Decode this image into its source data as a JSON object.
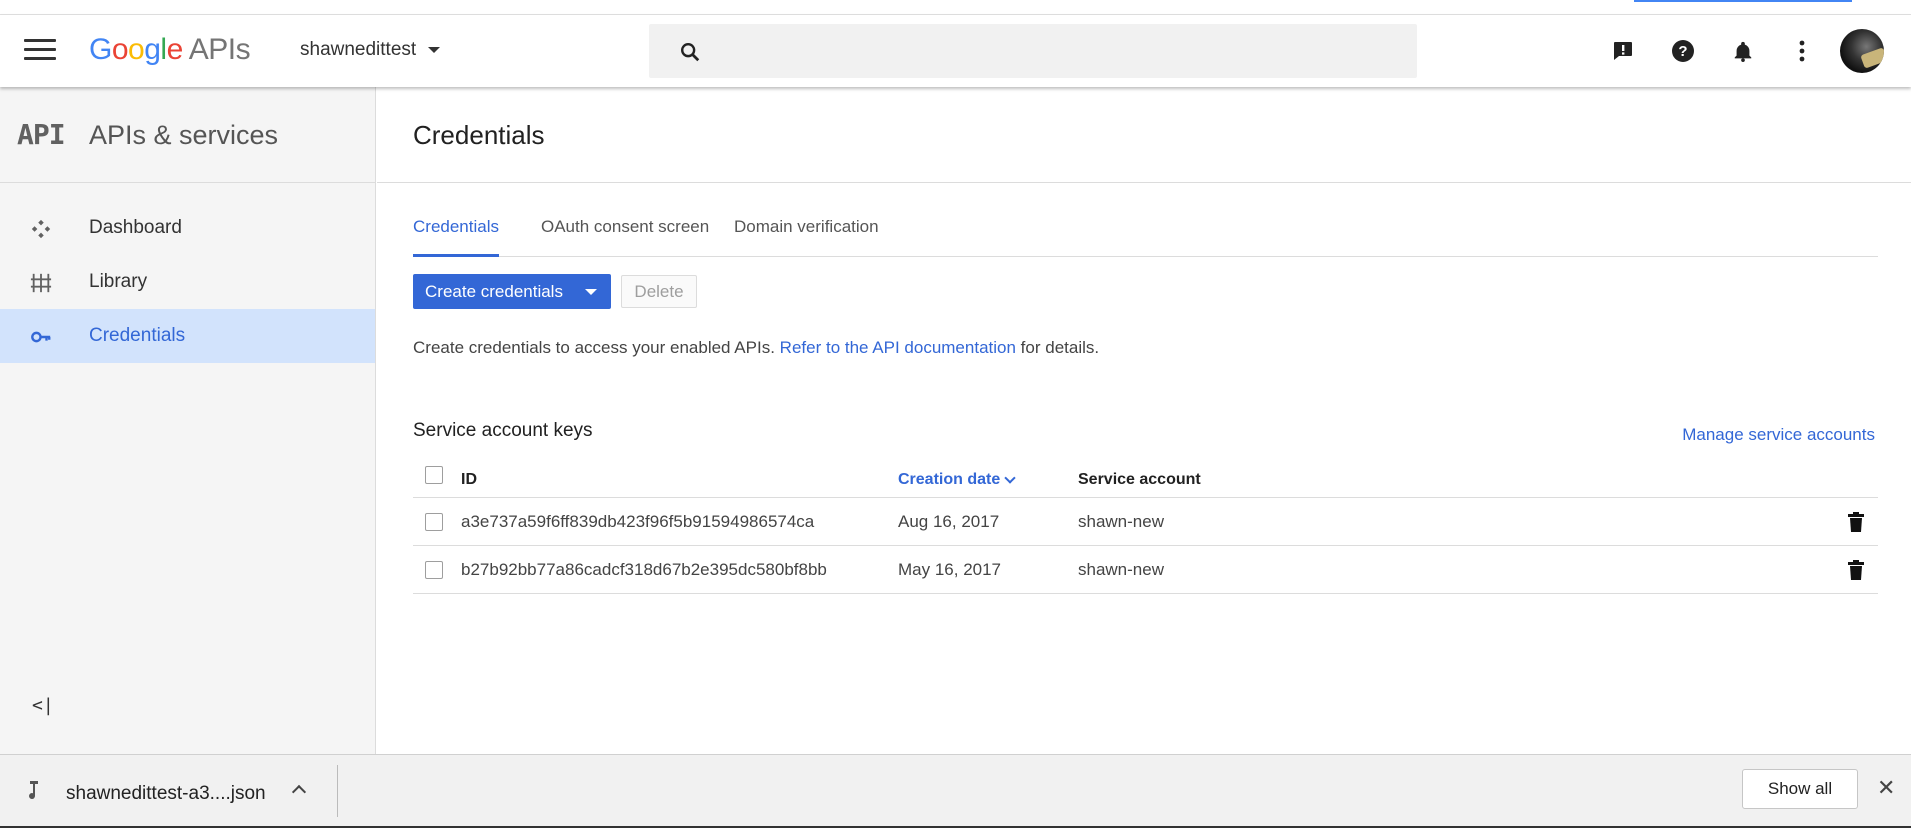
{
  "header": {
    "logo_google": [
      "G",
      "o",
      "o",
      "g",
      "l",
      "e"
    ],
    "logo_apis": "APIs",
    "project_name": "shawnedittest",
    "search_placeholder": "",
    "icons": [
      "menu-icon",
      "search-icon",
      "feedback-icon",
      "help-icon",
      "notifications-icon",
      "more-vert-icon",
      "account-avatar"
    ]
  },
  "sidebar": {
    "logo": "API",
    "title": "APIs & services",
    "items": [
      {
        "label": "Dashboard",
        "icon": "dashboard-icon"
      },
      {
        "label": "Library",
        "icon": "library-icon"
      },
      {
        "label": "Credentials",
        "icon": "key-icon",
        "active": true
      }
    ],
    "collapse_glyph": "<|"
  },
  "main": {
    "page_title": "Credentials",
    "tabs": [
      {
        "label": "Credentials",
        "active": true
      },
      {
        "label": "OAuth consent screen"
      },
      {
        "label": "Domain verification"
      }
    ],
    "create_button": "Create credentials",
    "delete_button": "Delete",
    "description_prefix": "Create credentials to access your enabled APIs.",
    "description_link": "Refer to the API documentation",
    "description_suffix": "for details.",
    "section_title": "Service account keys",
    "manage_link": "Manage service accounts",
    "table": {
      "columns": [
        "ID",
        "Creation date",
        "Service account"
      ],
      "sorted_column": "Creation date",
      "rows": [
        {
          "id": "a3e737a59f6ff839db423f96f5b91594986574ca",
          "date": "Aug 16, 2017",
          "account": "shawn-new"
        },
        {
          "id": "b27b92bb77a86cadcf318d67b2e395dc580bf8bb",
          "date": "May 16, 2017",
          "account": "shawn-new"
        }
      ]
    }
  },
  "download_bar": {
    "file_name": "shawnedittest-a3....json",
    "show_all": "Show all",
    "close_glyph": "✕"
  },
  "colors": {
    "accent": "#3367d6",
    "active_nav_bg": "#d2e3fc",
    "sidebar_bg": "#f5f5f5"
  }
}
